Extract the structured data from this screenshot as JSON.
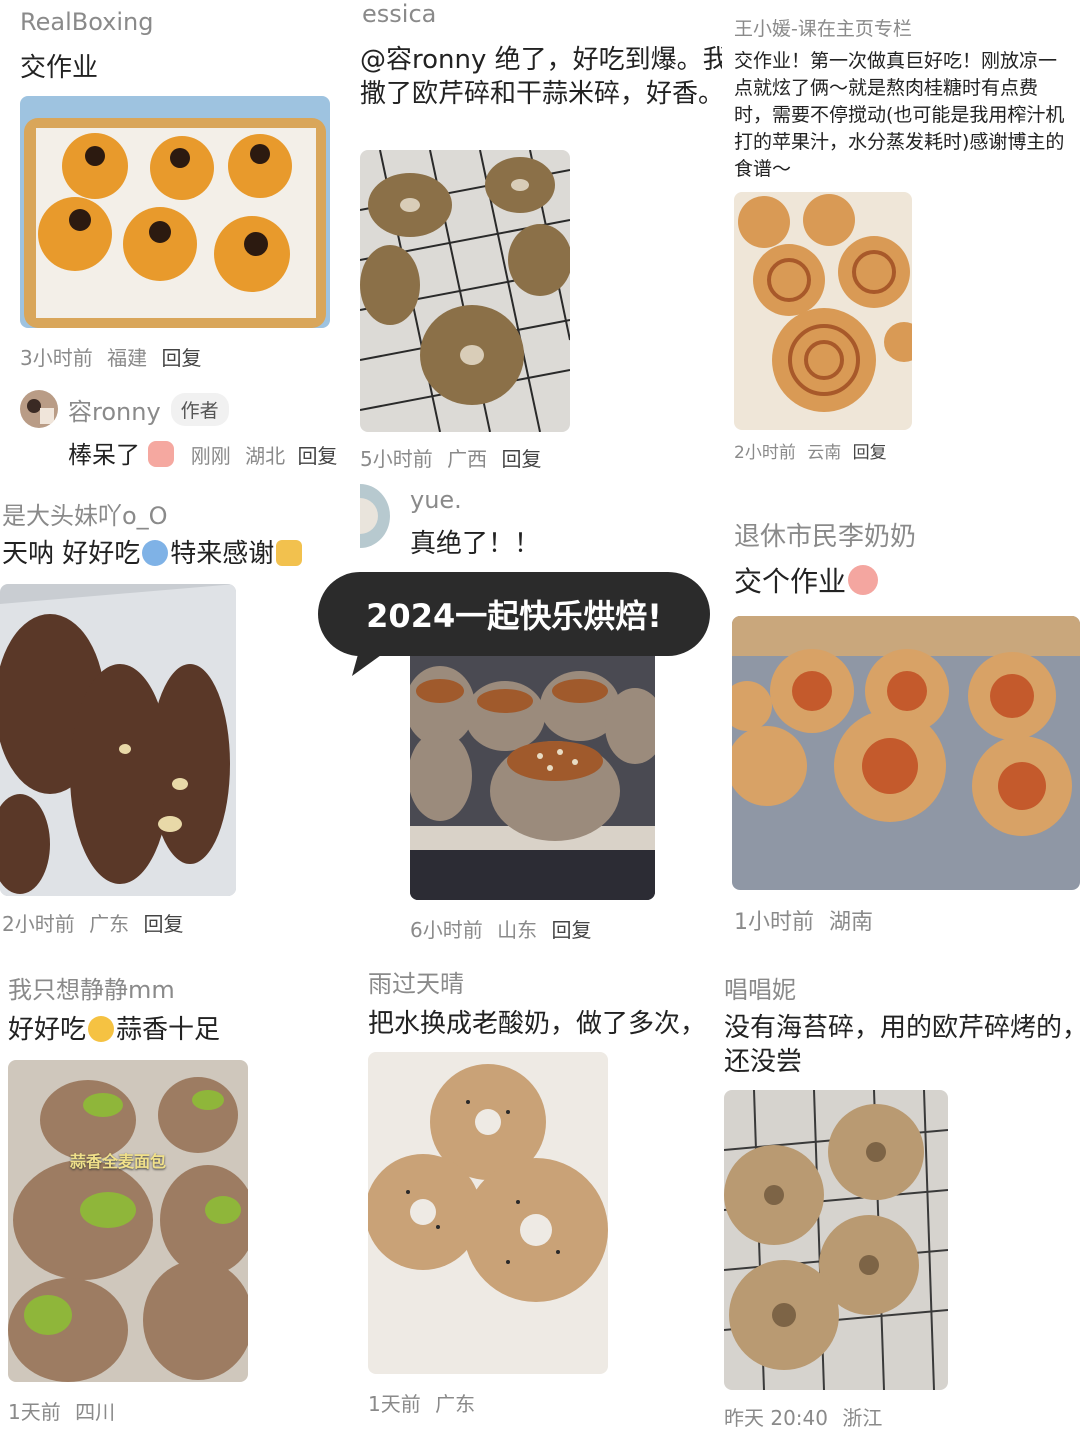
{
  "banner": {
    "text": "2024一起快乐烘焙!"
  },
  "cards": [
    {
      "user": "RealBoxing",
      "text": "交作业",
      "time": "3小时前",
      "location": "福建",
      "reply": "回复"
    },
    {
      "user": "essica",
      "text_lines": [
        "@容ronny 绝了，好吃到爆。我在",
        "撒了欧芹碎和干蒜米碎，好香。"
      ],
      "time": "5小时前",
      "location": "广西",
      "reply": "回复"
    },
    {
      "user": "王小媛-课在主页专栏",
      "text_lines": [
        "交作业！第一次做真巨好吃！刚放凉一",
        "点就炫了俩～就是熬肉桂糖时有点费",
        "时，需要不停搅动(也可能是我用榨汁机",
        "打的苹果汁，水分蒸发耗时)感谢博主的",
        "食谱～"
      ],
      "time": "2小时前",
      "location": "云南",
      "reply": "回复"
    },
    {
      "user": "是大头妹吖o_O",
      "text_a": "天呐 好好吃",
      "text_b": "特来感谢",
      "time": "2小时前",
      "location": "广东",
      "reply": "回复"
    },
    {
      "user": "yue.",
      "text": "真绝了！！",
      "time": "6小时前",
      "location": "山东",
      "reply": "回复"
    },
    {
      "user": "退休市民李奶奶",
      "text": "交个作业",
      "time": "1小时前",
      "location": "湖南"
    },
    {
      "user": "我只想静静mm",
      "text_a": "好好吃",
      "text_b": "蒜香十足",
      "photo_caption": "蒜香全麦面包",
      "time": "1天前",
      "location": "四川"
    },
    {
      "user": "雨过天晴",
      "text": "把水换成老酸奶，做了多次，",
      "time": "1天前",
      "location": "广东"
    },
    {
      "user": "唱唱妮",
      "text_lines": [
        "没有海苔碎，用的欧芹碎烤的，",
        "还没尝"
      ],
      "time": "昨天 20:40",
      "location": "浙江"
    }
  ],
  "reply_thread": {
    "user": "容ronny",
    "badge": "作者",
    "text": "棒呆了",
    "time": "刚刚",
    "location": "湖北",
    "reply": "回复"
  },
  "colors": {
    "muted": "#8a8a8a",
    "bubble": "#2b2b2b"
  }
}
